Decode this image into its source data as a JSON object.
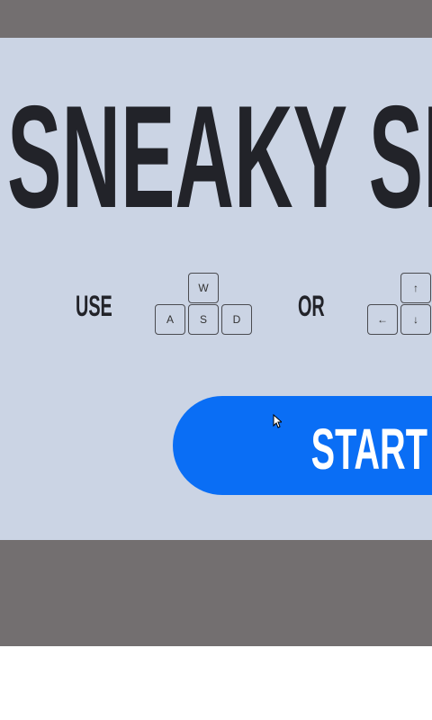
{
  "title": "SNEAKY SNAKE",
  "controls": {
    "use_label": "USE",
    "or_label": "OR",
    "wasd": [
      "W",
      "A",
      "S",
      "D"
    ],
    "arrows": [
      "↑",
      "←",
      "↓"
    ]
  },
  "start_label": "START",
  "colors": {
    "background": "#cbd4e4",
    "frame": "#736f70",
    "button": "#0a6ef5",
    "text": "#222329"
  }
}
